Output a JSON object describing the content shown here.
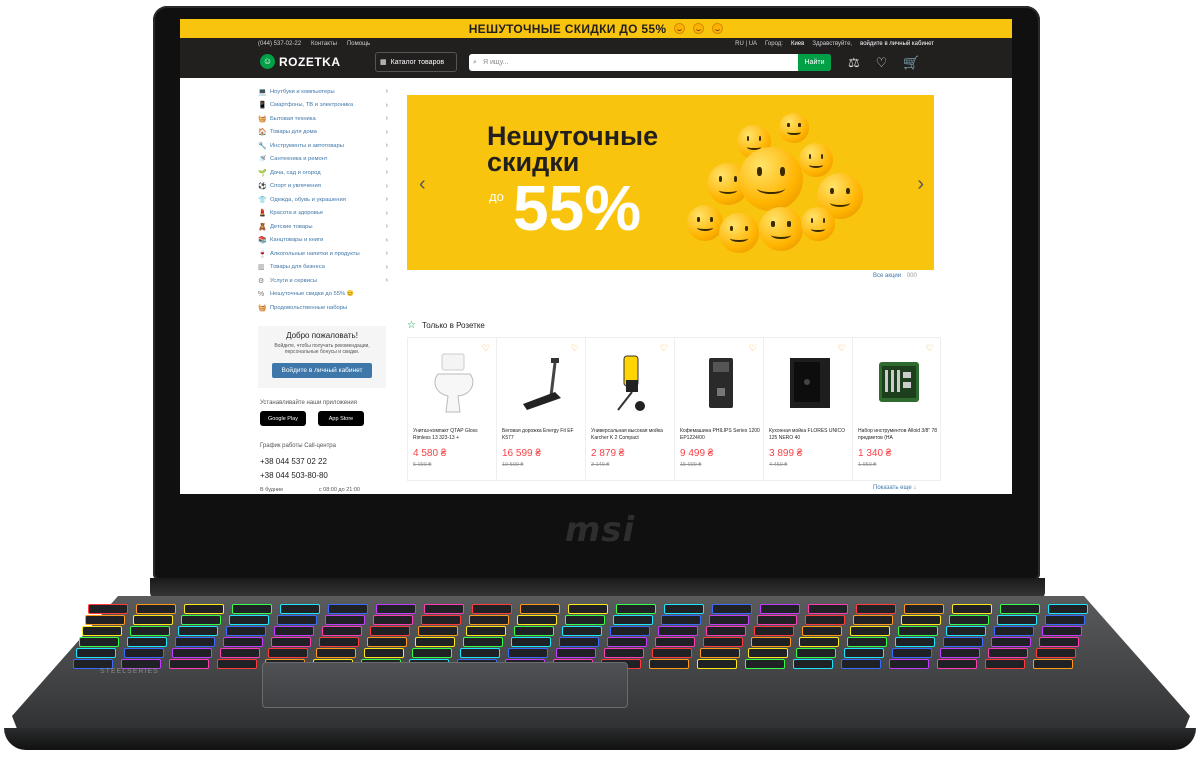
{
  "device": {
    "brand": "msi",
    "keyboard_label": "STEELSERIES"
  },
  "promo_bar": {
    "text": "НЕШУТОЧНЫЕ СКИДКИ ДО 55%"
  },
  "header": {
    "phone": "(044) 537-02-22",
    "links": [
      "Контакты",
      "Помощь"
    ],
    "lang": "RU | UA",
    "city_label": "Город:",
    "city": "Киев",
    "greeting": "Здравствуйте,",
    "login_link": "войдите в личный кабинет",
    "logo": "ROZETKA",
    "catalog_label": "Каталог товаров",
    "search_placeholder": "Я ищу...",
    "search_button": "Найти"
  },
  "sidebar": {
    "items": [
      {
        "label": "Ноутбуки и компьютеры",
        "chev": "›"
      },
      {
        "label": "Смартфоны, ТВ и электроника",
        "chev": "›"
      },
      {
        "label": "Бытовая техника",
        "chev": "›"
      },
      {
        "label": "Товары для дома",
        "chev": "›"
      },
      {
        "label": "Инструменты и автотовары",
        "chev": "›"
      },
      {
        "label": "Сантехника и ремонт",
        "chev": "›"
      },
      {
        "label": "Дача, сад и огород",
        "chev": "›"
      },
      {
        "label": "Спорт и увлечения",
        "chev": "›"
      },
      {
        "label": "Одежда, обувь и украшения",
        "chev": "›"
      },
      {
        "label": "Красота и здоровье",
        "chev": "›"
      },
      {
        "label": "Детские товары",
        "chev": "›"
      },
      {
        "label": "Канцтовары и книги",
        "chev": "›"
      },
      {
        "label": "Алкогольные напитки и продукты",
        "chev": "›"
      },
      {
        "label": "Товары для бизнеса",
        "chev": "›"
      },
      {
        "label": "Услуги и сервисы",
        "chev": "›"
      },
      {
        "label": "Нешуточные скидки до 55% 😊",
        "chev": ""
      },
      {
        "label": "Продовольственные наборы",
        "chev": ""
      }
    ],
    "welcome_title": "Добро пожаловать!",
    "welcome_text": "Войдите, чтобы получать рекомендации, персональные бонусы и скидки.",
    "login_button": "Войдите в личный кабинет",
    "apps_title": "Устанавливайте наши приложения",
    "google_play": "Google Play",
    "app_store": "App Store",
    "callcenter_title": "График работы Call-центра",
    "phones": [
      "+38 044 537 02 22",
      "+38 044 503-80-80"
    ],
    "weekday_label": "В будние",
    "weekday_hours": "с 08:00 до 21:00"
  },
  "banner": {
    "line1": "Нешуточные",
    "line2": "скидки",
    "prefix": "до",
    "percent": "55%",
    "all_promos": "Все акции",
    "all_promos_count": "000"
  },
  "section": {
    "title": "Только в Розетке",
    "more": "Показать еще ↓"
  },
  "products": [
    {
      "name": "Унитаз-компакт QTAP Gloss Rimless 13 323-13 +",
      "price": "4 580 ₴",
      "old": "5 090 ₴",
      "kind": "toilet"
    },
    {
      "name": "Беговая дорожка Energy Fit EF K577",
      "price": "16 599 ₴",
      "old": "19 599 ₴",
      "kind": "treadmill"
    },
    {
      "name": "Универсальная высокая мойка Karcher K 2 Compact",
      "price": "2 879 ₴",
      "old": "3 149 ₴",
      "kind": "washer"
    },
    {
      "name": "Кофемашина PHILIPS Series 1200 EP1224/00",
      "price": "9 499 ₴",
      "old": "15 999 ₴",
      "kind": "coffee"
    },
    {
      "name": "Кухонная мойка FLORES UNICO 125 NERO 40",
      "price": "3 899 ₴",
      "old": "4 459 ₴",
      "kind": "sink"
    },
    {
      "name": "Набор инструментов Alloid 3/8\" 78 предметов (НА",
      "price": "1 340 ₴",
      "old": "1 950 ₴",
      "kind": "tools"
    }
  ],
  "colors": {
    "accent_yellow": "#f9c40d",
    "brand_green": "#00a046",
    "price_red": "#f84147",
    "header_dark": "#221f1f",
    "link_blue": "#3e77aa"
  }
}
